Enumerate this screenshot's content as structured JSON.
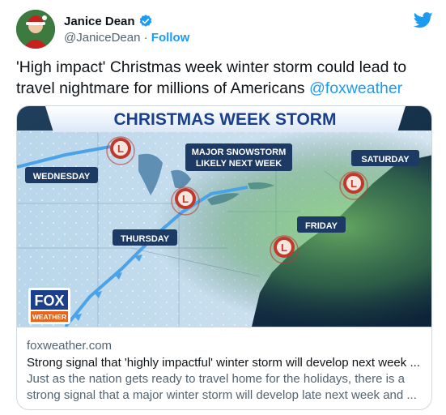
{
  "author": {
    "name": "Janice Dean",
    "handle": "@JaniceDean",
    "separator": "·",
    "follow_label": "Follow"
  },
  "tweet": {
    "text": "'High impact' Christmas week winter storm could lead to travel nightmare for millions of Americans",
    "mention": "@foxweather"
  },
  "map": {
    "banner": "CHRISTMAS WEEK STORM",
    "labels": {
      "wednesday": "WEDNESDAY",
      "thursday": "THURSDAY",
      "friday": "FRIDAY",
      "saturday": "SATURDAY",
      "major_line1": "MAJOR SNOWSTORM",
      "major_line2": "LIKELY NEXT WEEK"
    },
    "low_symbol": "L",
    "logo_top": "FOX",
    "logo_bottom": "WEATHER"
  },
  "card": {
    "domain": "foxweather.com",
    "title": "Strong signal that 'highly impactful' winter storm will develop next week ...",
    "description": "Just as the nation gets ready to travel home for the holidays, there is a strong signal that a major winter storm will develop late next week and ..."
  },
  "colors": {
    "accent": "#1d9bf0",
    "banner_text": "#1a3f8c",
    "low_red": "#c0392b"
  }
}
